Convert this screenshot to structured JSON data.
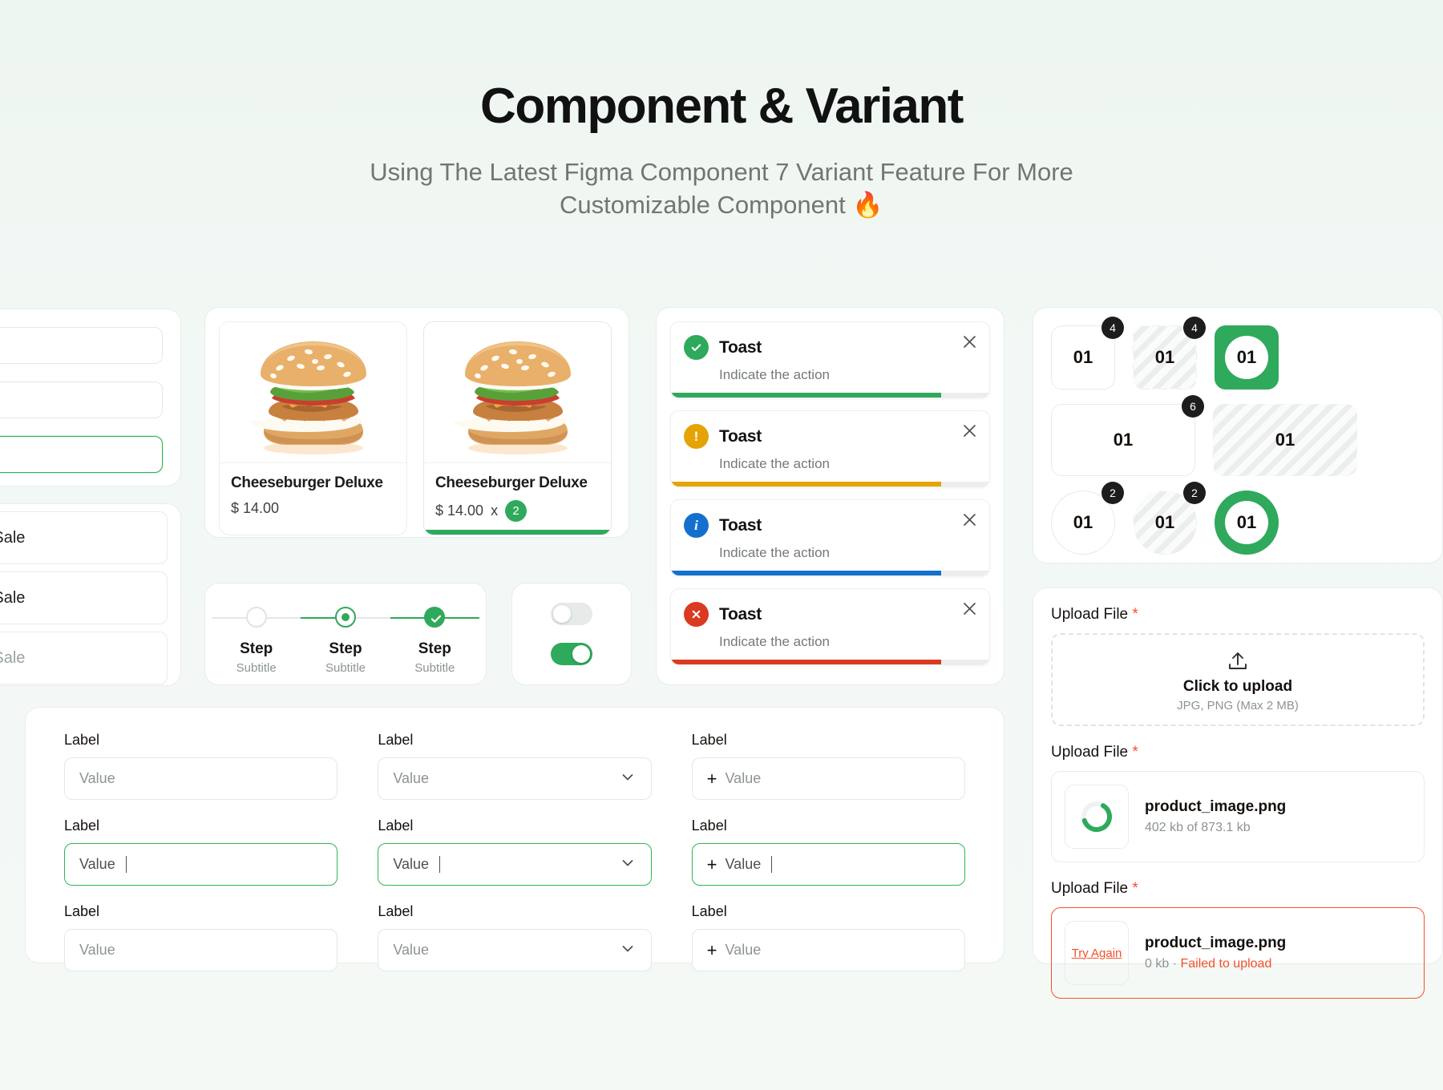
{
  "header": {
    "title": "Component & Variant",
    "subtitle": "Using The Latest Figma Component 7 Variant Feature For More Customizable Component 🔥"
  },
  "colors": {
    "green": "#2fa95b",
    "amber": "#e6a306",
    "blue": "#1570cd",
    "red": "#d93a21",
    "orange": "#f4502a",
    "dark": "#1d1d1d"
  },
  "left_list": {
    "items": [
      {
        "label": "Point of Sale",
        "state": "default"
      },
      {
        "label": "Point of Sale",
        "state": "default"
      },
      {
        "label": "Point of Sale",
        "state": "muted"
      }
    ]
  },
  "products": {
    "cards": [
      {
        "title": "Cheeseburger Deluxe",
        "price": "$ 14.00",
        "qty": null,
        "multiplier": null,
        "selected": false
      },
      {
        "title": "Cheeseburger Deluxe",
        "price": "$ 14.00",
        "qty": "2",
        "multiplier": "x",
        "selected": true
      }
    ]
  },
  "stepper": {
    "steps": [
      {
        "label": "Step",
        "subtitle": "Subtitle",
        "state": "pending"
      },
      {
        "label": "Step",
        "subtitle": "Subtitle",
        "state": "active"
      },
      {
        "label": "Step",
        "subtitle": "Subtitle",
        "state": "done"
      }
    ]
  },
  "toggles": [
    {
      "state": "off"
    },
    {
      "state": "on"
    }
  ],
  "toasts": [
    {
      "title": "Toast",
      "description": "Indicate the action",
      "icon": "check-circle-icon",
      "glyph": "✓",
      "color": "#2fa95b",
      "progress": 85
    },
    {
      "title": "Toast",
      "description": "Indicate the action",
      "icon": "warning-circle-icon",
      "glyph": "!",
      "color": "#e6a306",
      "progress": 85
    },
    {
      "title": "Toast",
      "description": "Indicate the action",
      "icon": "info-circle-icon",
      "glyph": "i",
      "color": "#1570cd",
      "progress": 85
    },
    {
      "title": "Toast",
      "description": "Indicate the action",
      "icon": "error-circle-icon",
      "glyph": "✕",
      "color": "#d93a21",
      "progress": 85
    }
  ],
  "counters": {
    "rows": [
      [
        {
          "value": "01",
          "badge": "4",
          "shape": "square",
          "style": "outline"
        },
        {
          "value": "01",
          "badge": "4",
          "shape": "square",
          "style": "hatch"
        },
        {
          "value": "01",
          "badge": null,
          "shape": "square",
          "style": "filled"
        }
      ],
      [
        {
          "value": "01",
          "badge": "6",
          "shape": "wide",
          "style": "outline"
        },
        {
          "value": "01",
          "badge": null,
          "shape": "wide",
          "style": "hatch"
        }
      ],
      [
        {
          "value": "01",
          "badge": "2",
          "shape": "circle",
          "style": "outline"
        },
        {
          "value": "01",
          "badge": "2",
          "shape": "circle",
          "style": "hatch"
        },
        {
          "value": "01",
          "badge": null,
          "shape": "circle",
          "style": "filled"
        }
      ]
    ]
  },
  "upload": {
    "sections": [
      {
        "label": "Upload File",
        "required": "*",
        "kind": "dropzone",
        "cta": "Click to upload",
        "hint": "JPG, PNG (Max 2 MB)",
        "icon": "upload-icon"
      },
      {
        "label": "Upload File",
        "required": "*",
        "kind": "progress",
        "file_name": "product_image.png",
        "file_meta": "402 kb of 873.1 kb",
        "percent": 62
      },
      {
        "label": "Upload File",
        "required": "*",
        "kind": "error",
        "file_name": "product_image.png",
        "file_size": "0 kb",
        "separator": "·",
        "error_text": "Failed to upload",
        "retry_label": "Try Again"
      }
    ]
  },
  "form": {
    "columns": [
      {
        "type": "text",
        "rows": [
          {
            "label": "Label",
            "value": "",
            "placeholder": "Value",
            "state": "default"
          },
          {
            "label": "Label",
            "value": "Value",
            "placeholder": "Value",
            "state": "focused"
          },
          {
            "label": "Label",
            "value": "",
            "placeholder": "Value",
            "state": "default"
          }
        ]
      },
      {
        "type": "select",
        "rows": [
          {
            "label": "Label",
            "value": "",
            "placeholder": "Value",
            "state": "default"
          },
          {
            "label": "Label",
            "value": "Value",
            "placeholder": "Value",
            "state": "focused"
          },
          {
            "label": "Label",
            "value": "",
            "placeholder": "Value",
            "state": "default"
          }
        ]
      },
      {
        "type": "add",
        "rows": [
          {
            "label": "Label",
            "value": "",
            "placeholder": "Value",
            "state": "default"
          },
          {
            "label": "Label",
            "value": "Value",
            "placeholder": "Value",
            "state": "focused"
          },
          {
            "label": "Label",
            "value": "",
            "placeholder": "Value",
            "state": "default"
          }
        ]
      }
    ]
  },
  "left_inputs": {
    "fields": [
      {
        "state": "default"
      },
      {
        "state": "default"
      },
      {
        "state": "focused"
      }
    ]
  }
}
